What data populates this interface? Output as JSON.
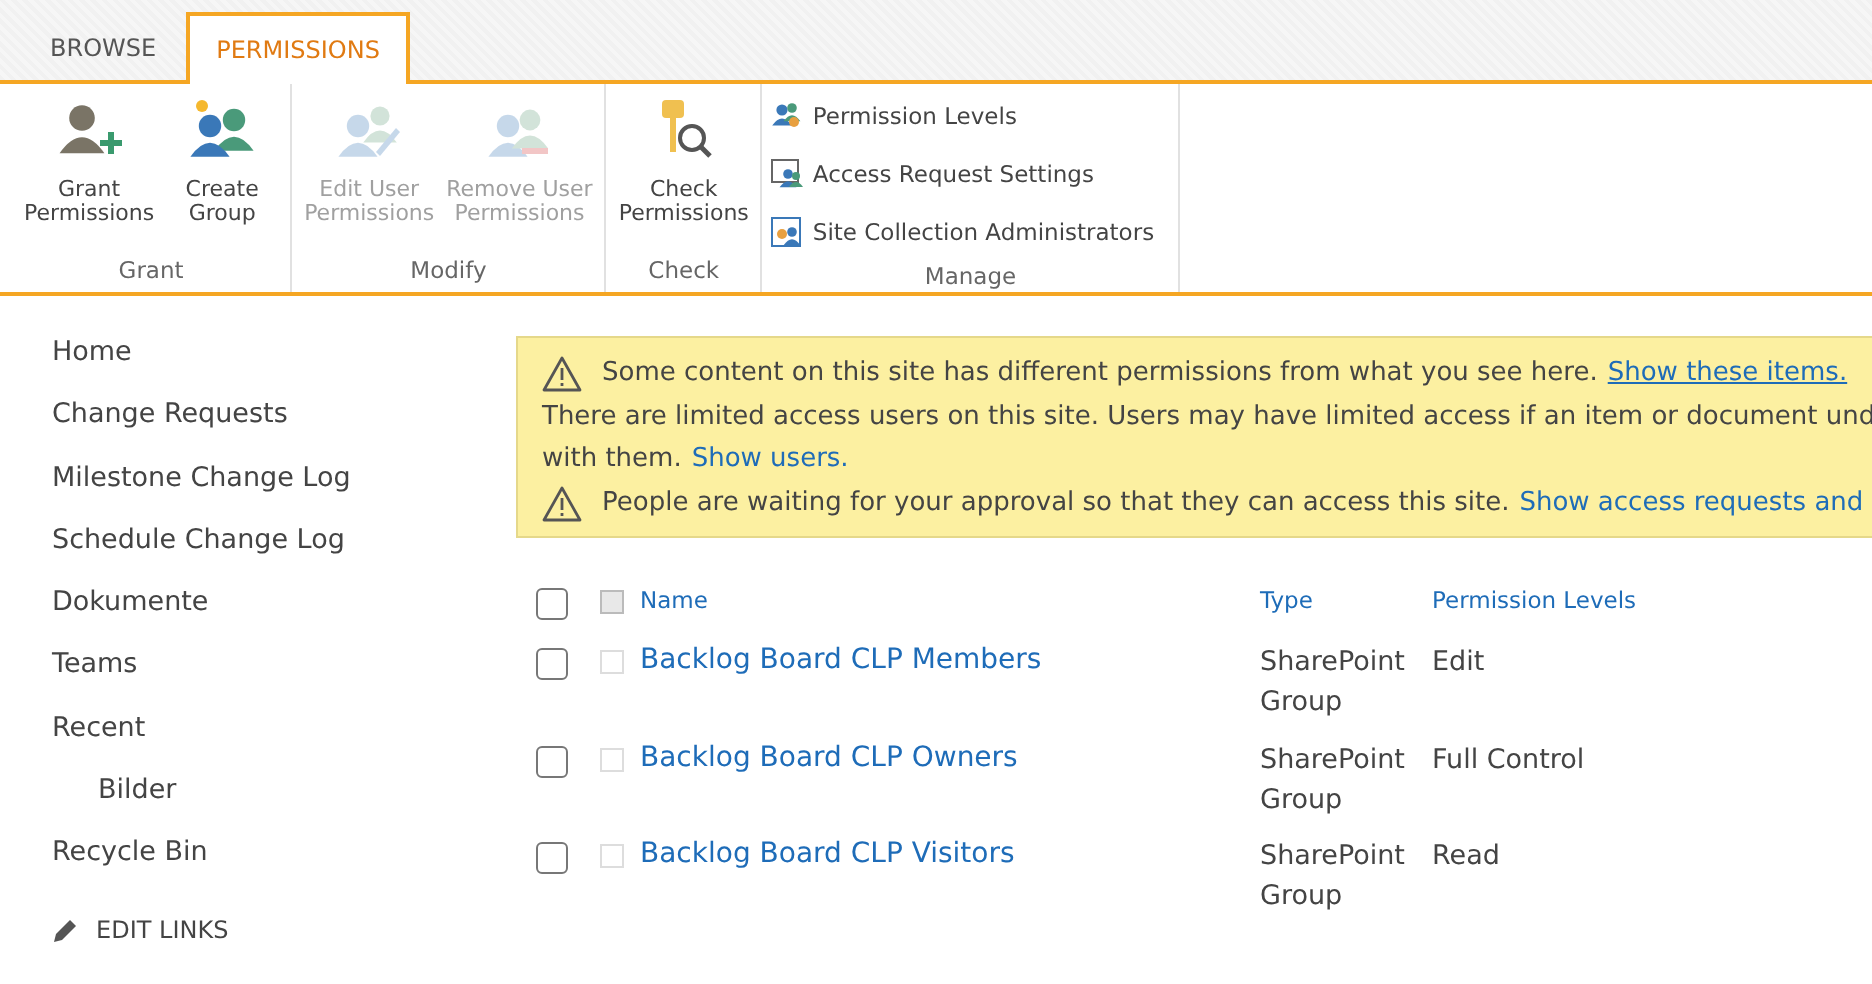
{
  "ribbon_tabs": [
    {
      "label": "BROWSE",
      "selected": false
    },
    {
      "label": "PERMISSIONS",
      "selected": true
    }
  ],
  "ribbon_groups": [
    {
      "label": "Grant",
      "kind": "large",
      "buttons": [
        {
          "label": "Grant Permissions",
          "disabled": false
        },
        {
          "label": "Create Group",
          "disabled": false
        }
      ]
    },
    {
      "label": "Modify",
      "kind": "large",
      "buttons": [
        {
          "label": "Edit User Permissions",
          "disabled": true
        },
        {
          "label": "Remove User Permissions",
          "disabled": true
        }
      ]
    },
    {
      "label": "Check",
      "kind": "large",
      "buttons": [
        {
          "label": "Check Permissions",
          "disabled": false
        }
      ]
    },
    {
      "label": "Manage",
      "kind": "small",
      "buttons": [
        {
          "label": "Permission Levels",
          "disabled": false
        },
        {
          "label": "Access Request Settings",
          "disabled": false
        },
        {
          "label": "Site Collection Administrators",
          "disabled": false
        }
      ]
    }
  ],
  "sidebar": {
    "items": [
      {
        "label": "Home"
      },
      {
        "label": "Change Requests"
      },
      {
        "label": "Milestone Change Log"
      },
      {
        "label": "Schedule Change Log"
      },
      {
        "label": "Dokumente"
      },
      {
        "label": "Teams"
      },
      {
        "label": "Recent",
        "children": [
          {
            "label": "Bilder"
          }
        ]
      },
      {
        "label": "Recycle Bin"
      }
    ],
    "edit_links": "EDIT LINKS"
  },
  "banner": {
    "messages": [
      {
        "kind": "warning",
        "lines": [
          "Some content on this site has different permissions from what you see here."
        ],
        "link": "Show these items."
      },
      {
        "kind": "plain",
        "lines": [
          "There are limited access users on this site. Users may have limited access if an item or document und",
          "with them."
        ],
        "link": "Show users."
      },
      {
        "kind": "warning",
        "lines": [
          "People are waiting for your approval so that they can access this site."
        ],
        "link": "Show access requests and"
      }
    ]
  },
  "table": {
    "select_all": {
      "checked": false
    },
    "columns": [
      "Name",
      "Type",
      "Permission Levels"
    ],
    "rows": [
      {
        "checked": false,
        "name": "Backlog Board CLP Members",
        "type": "SharePoint Group",
        "permission": "Edit"
      },
      {
        "checked": false,
        "name": "Backlog Board CLP Owners",
        "type": "SharePoint Group",
        "permission": "Full Control"
      },
      {
        "checked": false,
        "name": "Backlog Board CLP Visitors",
        "type": "SharePoint Group",
        "permission": "Read"
      }
    ]
  }
}
